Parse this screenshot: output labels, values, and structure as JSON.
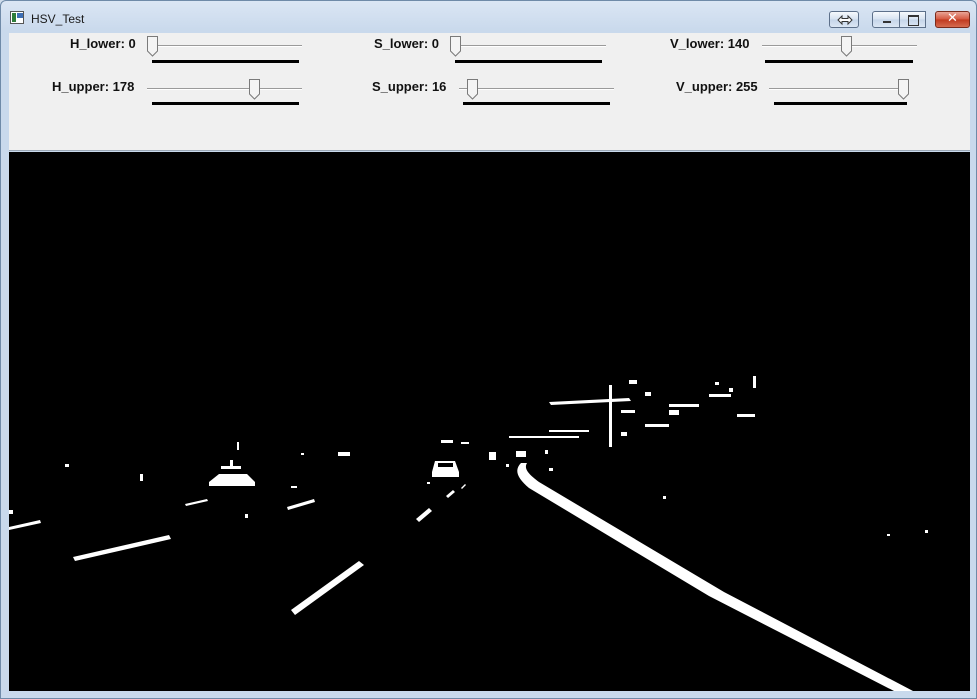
{
  "window": {
    "title": "HSV_Test",
    "icon": "app-window-icon"
  },
  "title_buttons": {
    "expand_icon": "double-arrow-icon",
    "minimize_icon": "minimize-icon",
    "maximize_icon": "maximize-icon",
    "close_label": "✕"
  },
  "trackbars": [
    {
      "id": "h_lower",
      "label": "H_lower: 0",
      "value": 0,
      "max": 179
    },
    {
      "id": "s_lower",
      "label": "S_lower: 0",
      "value": 0,
      "max": 255
    },
    {
      "id": "v_lower",
      "label": "V_lower: 140",
      "value": 140,
      "max": 255
    },
    {
      "id": "h_upper",
      "label": "H_upper: 178",
      "value": 178,
      "max": 255
    },
    {
      "id": "s_upper",
      "label": "S_upper: 16",
      "value": 16,
      "max": 255
    },
    {
      "id": "v_upper",
      "label": "V_upper: 255",
      "value": 255,
      "max": 255
    }
  ],
  "image": {
    "description_name": "hsv-thresholded-road-mask",
    "background_color": "#000000",
    "foreground_color": "#ffffff"
  }
}
